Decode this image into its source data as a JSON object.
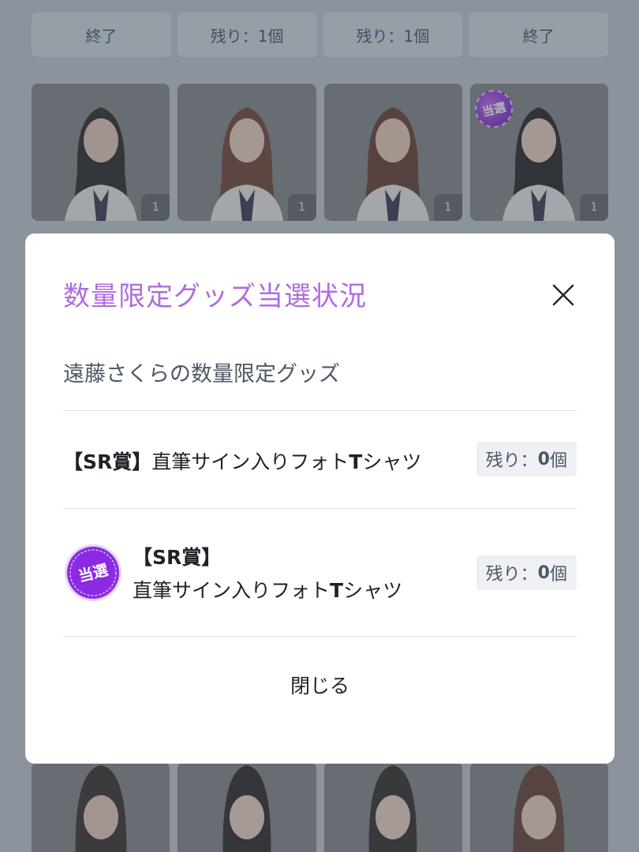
{
  "background": {
    "status_pills": [
      "終了",
      "残り：1個",
      "残り：1個",
      "終了"
    ],
    "top_cards": [
      {
        "count": "1",
        "winner": false
      },
      {
        "count": "1",
        "winner": false
      },
      {
        "count": "1",
        "winner": false
      },
      {
        "count": "1",
        "winner": true
      }
    ],
    "winner_stamp_label": "当選"
  },
  "modal": {
    "title": "数量限定グッズ当選状況",
    "subtitle": "遠藤さくらの数量限定グッズ",
    "prizes": [
      {
        "name_prefix": "【SR賞】",
        "name_body": "直筆サイン入りフォト",
        "name_bold": "T",
        "name_tail": "シャツ",
        "remaining_label": "残り：",
        "remaining_count": "0",
        "remaining_unit": "個"
      },
      {
        "name_prefix": "【SR賞】",
        "name_body": "直筆サイン入りフォト",
        "name_bold": "T",
        "name_tail": "シャツ",
        "remaining_label": "残り：",
        "remaining_count": "0",
        "remaining_unit": "個",
        "stamp_label": "当選"
      }
    ],
    "close_label": "閉じる"
  },
  "colors": {
    "title_accent": "#b16be0",
    "stamp_purple": "#8a2be2",
    "overlay": "#50586273"
  }
}
